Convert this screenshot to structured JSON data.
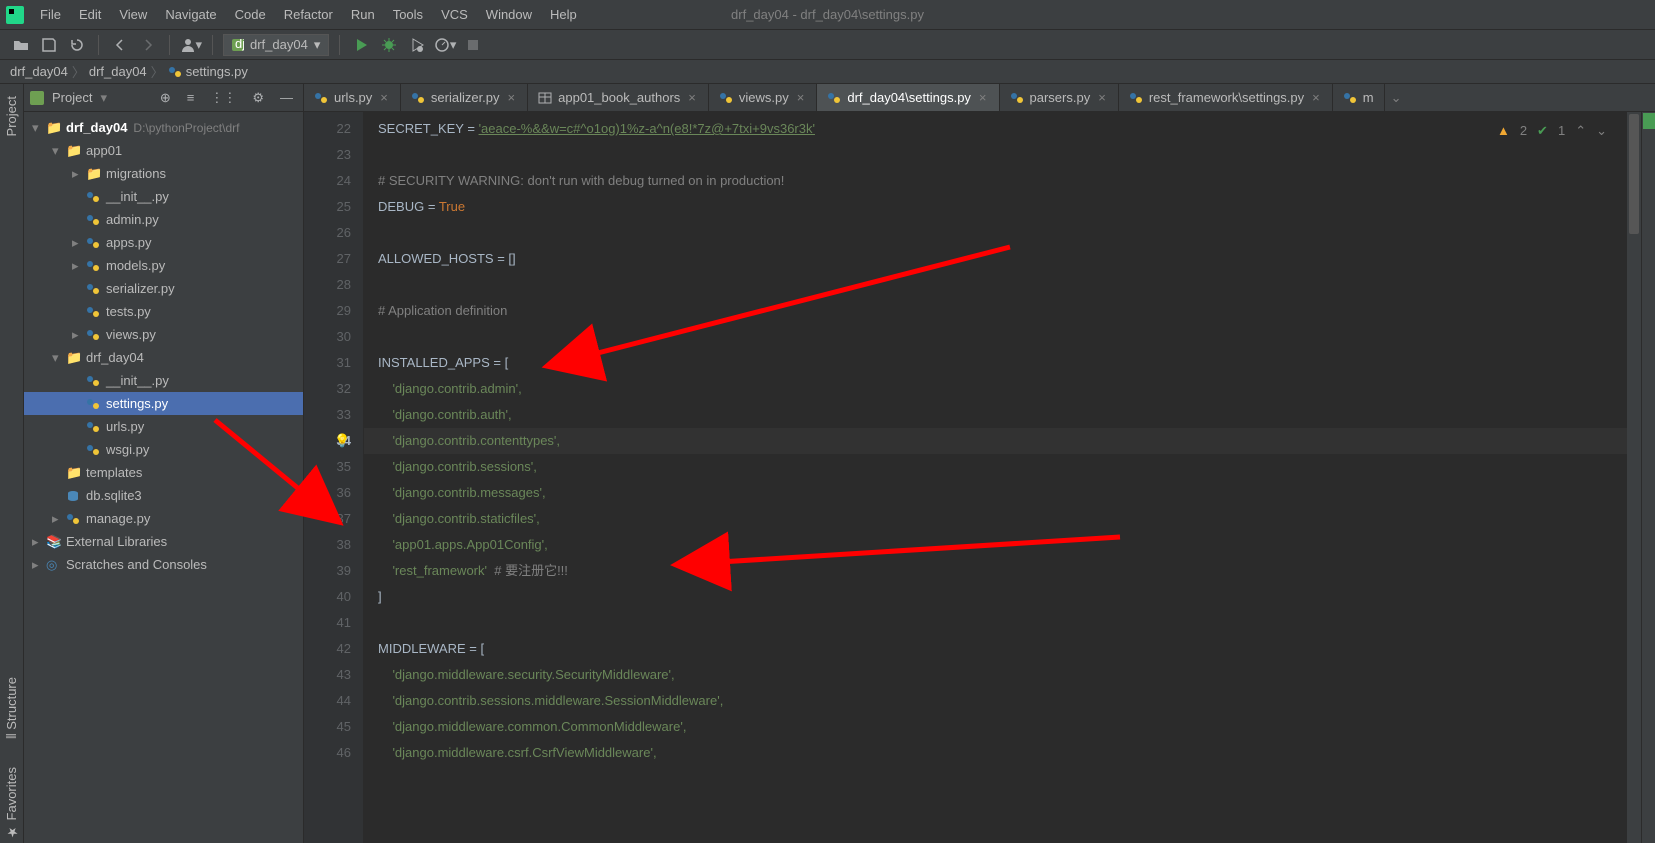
{
  "window_title": "drf_day04 - drf_day04\\settings.py",
  "menu": [
    "File",
    "Edit",
    "View",
    "Navigate",
    "Code",
    "Refactor",
    "Run",
    "Tools",
    "VCS",
    "Window",
    "Help"
  ],
  "run_config": "drf_day04",
  "breadcrumbs": [
    "drf_day04",
    "drf_day04",
    "settings.py"
  ],
  "sidebar_title": "Project",
  "tree": {
    "root": {
      "name": "drf_day04",
      "path": "D:\\pythonProject\\drf"
    },
    "app01": "app01",
    "migrations": "migrations",
    "init": "__init__.py",
    "admin": "admin.py",
    "apps": "apps.py",
    "models": "models.py",
    "serializer": "serializer.py",
    "tests": "tests.py",
    "views": "views.py",
    "drfdir": "drf_day04",
    "init2": "__init__.py",
    "settings": "settings.py",
    "urls": "urls.py",
    "wsgi": "wsgi.py",
    "templates": "templates",
    "db": "db.sqlite3",
    "manage": "manage.py",
    "ext": "External Libraries",
    "scratch": "Scratches and Consoles"
  },
  "tabs": [
    {
      "label": "urls.py"
    },
    {
      "label": "serializer.py"
    },
    {
      "label": "app01_book_authors"
    },
    {
      "label": "views.py"
    },
    {
      "label": "drf_day04\\settings.py"
    },
    {
      "label": "parsers.py"
    },
    {
      "label": "rest_framework\\settings.py"
    },
    {
      "label": "m"
    }
  ],
  "status": {
    "warn_count": "2",
    "check_count": "1"
  },
  "code": {
    "l22a": "SECRET_KEY = ",
    "l22b": "'aeace-%&&w=c#^o1og)1%z-a^n(e8!*7z@+7txi+9vs36r3k'",
    "l24": "# SECURITY WARNING: don't run with debug turned on in production!",
    "l25a": "DEBUG = ",
    "l25b": "True",
    "l27": "ALLOWED_HOSTS = []",
    "l29": "# Application definition",
    "l31": "INSTALLED_APPS = [",
    "l32": "    'django.contrib.admin',",
    "l33": "    'django.contrib.auth',",
    "l34": "    'django.contrib.contenttypes',",
    "l35": "    'django.contrib.sessions',",
    "l36": "    'django.contrib.messages',",
    "l37": "    'django.contrib.staticfiles',",
    "l38": "    'app01.apps.App01Config',",
    "l39a": "    'rest_framework'",
    "l39b": "  # 要注册它!!!",
    "l40": "]",
    "l42": "MIDDLEWARE = [",
    "l43": "    'django.middleware.security.SecurityMiddleware',",
    "l44": "    'django.contrib.sessions.middleware.SessionMiddleware',",
    "l45": "    'django.middleware.common.CommonMiddleware',",
    "l46": "    'django.middleware.csrf.CsrfViewMiddleware',"
  },
  "line_numbers": [
    "22",
    "23",
    "24",
    "25",
    "26",
    "27",
    "28",
    "29",
    "30",
    "31",
    "32",
    "33",
    "34",
    "35",
    "36",
    "37",
    "38",
    "39",
    "40",
    "41",
    "42",
    "43",
    "44",
    "45",
    "46"
  ]
}
